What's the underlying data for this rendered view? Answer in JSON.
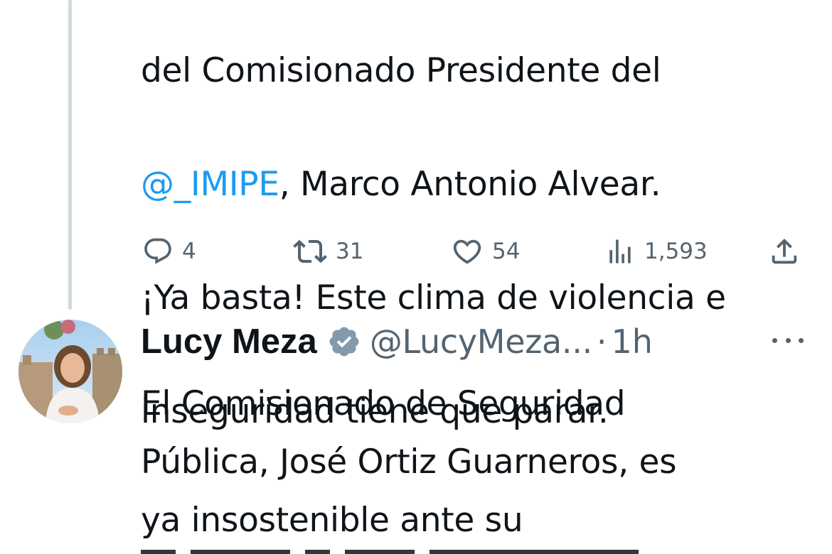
{
  "tweet1": {
    "lines": [
      {
        "parts": [
          {
            "text": "del Comisionado Presidente del",
            "mention": false
          }
        ]
      },
      {
        "parts": [
          {
            "text": "@_IMIPE",
            "mention": true
          },
          {
            "text": ", Marco Antonio Alvear.",
            "mention": false
          }
        ]
      },
      {
        "parts": [
          {
            "text": "¡Ya basta! Este clima de violencia e",
            "mention": false
          }
        ]
      },
      {
        "parts": [
          {
            "text": "inseguridad tiene que parar.",
            "mention": false
          }
        ]
      }
    ],
    "actions": {
      "reply_count": "4",
      "retweet_count": "31",
      "like_count": "54",
      "views_count": "1,593"
    }
  },
  "tweet2": {
    "author_name": "Lucy Meza",
    "handle": "@LucyMeza...",
    "separator": "·",
    "time": "1h",
    "lines": [
      "El Comisionado de Seguridad",
      "Pública, José Ortiz Guarneros, es",
      "ya insostenible ante su"
    ]
  },
  "icons": {
    "reply": "reply-icon",
    "retweet": "retweet-icon",
    "like": "like-icon",
    "views": "views-icon",
    "share": "share-icon",
    "verified": "verified-badge-icon",
    "more": "more-options-icon"
  },
  "colors": {
    "text": "#0f1419",
    "secondary": "#536471",
    "mention": "#1d9bf0",
    "thread_line": "#cfd9de"
  }
}
